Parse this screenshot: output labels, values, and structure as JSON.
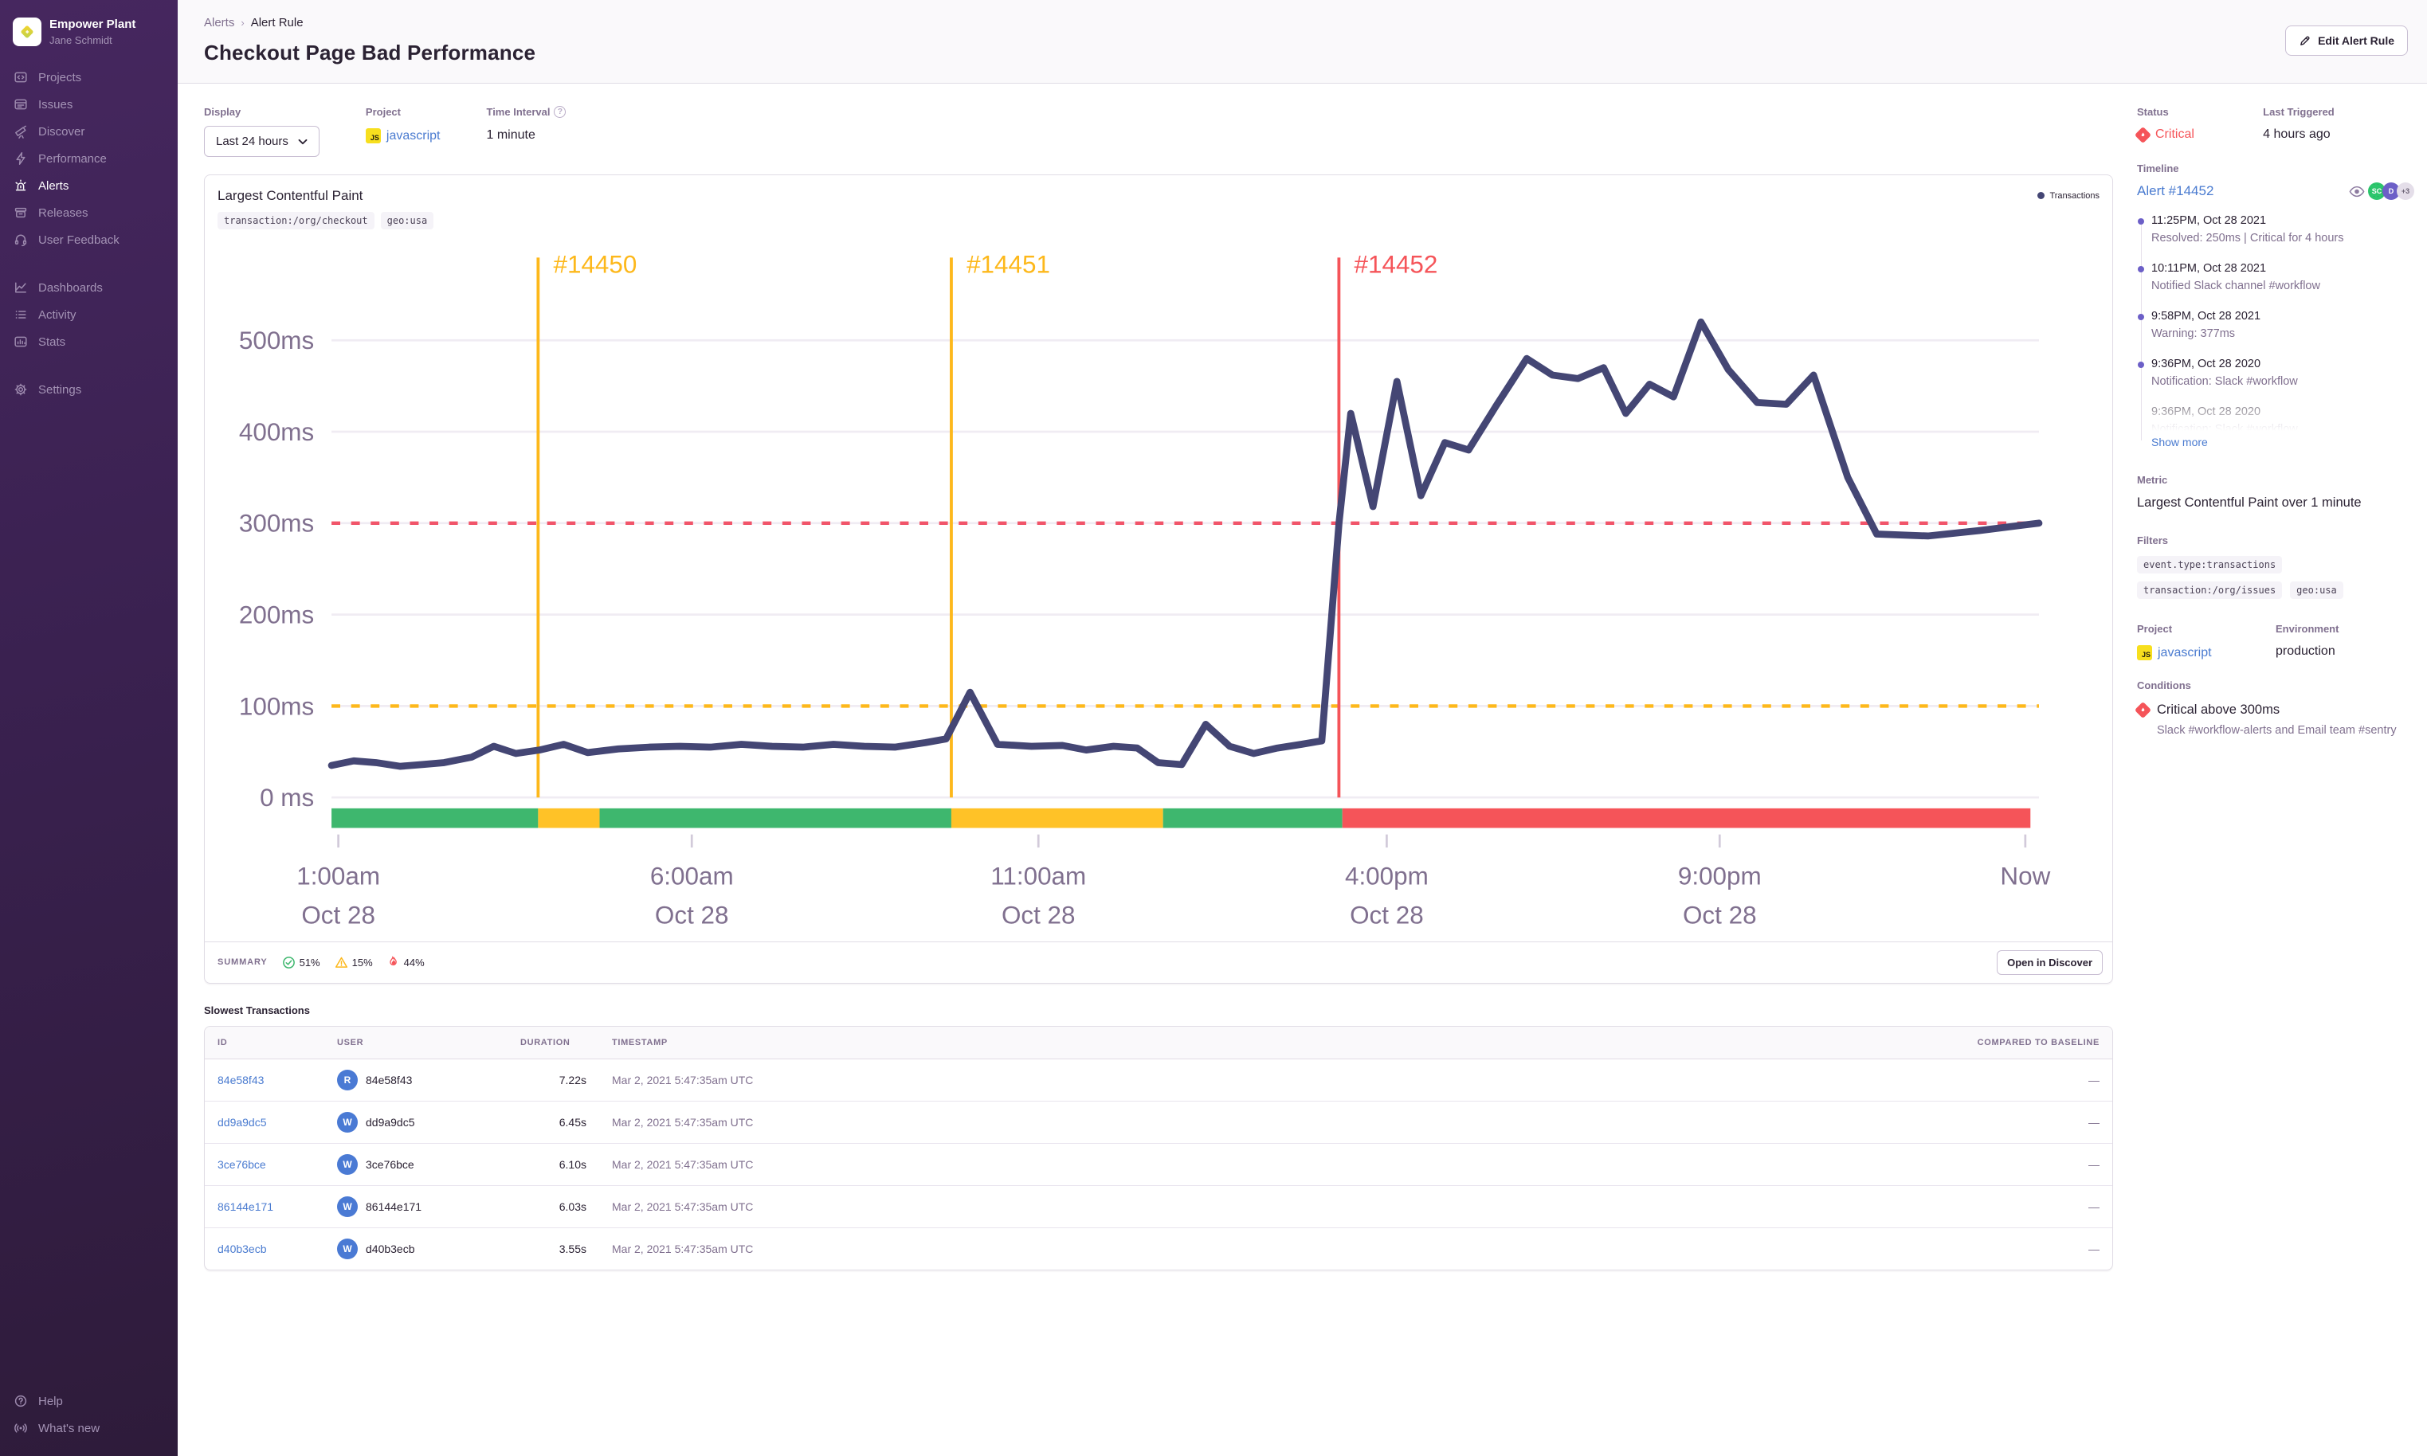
{
  "sidebar": {
    "org_name": "Empower Plant",
    "org_user": "Jane Schmidt",
    "items": [
      {
        "label": "Projects",
        "icon": "projects-icon",
        "active": false
      },
      {
        "label": "Issues",
        "icon": "issues-icon",
        "active": false
      },
      {
        "label": "Discover",
        "icon": "discover-icon",
        "active": false
      },
      {
        "label": "Performance",
        "icon": "performance-icon",
        "active": false
      },
      {
        "label": "Alerts",
        "icon": "alerts-icon",
        "active": true
      },
      {
        "label": "Releases",
        "icon": "releases-icon",
        "active": false
      },
      {
        "label": "User Feedback",
        "icon": "user-feedback-icon",
        "active": false
      },
      {
        "label": "Dashboards",
        "icon": "dashboards-icon",
        "active": false
      },
      {
        "label": "Activity",
        "icon": "activity-icon",
        "active": false
      },
      {
        "label": "Stats",
        "icon": "stats-icon",
        "active": false
      },
      {
        "label": "Settings",
        "icon": "settings-icon",
        "active": false
      }
    ],
    "footer_items": [
      {
        "label": "Help",
        "icon": "help-icon"
      },
      {
        "label": "What's new",
        "icon": "whats-new-icon"
      }
    ]
  },
  "header": {
    "breadcrumb": [
      "Alerts",
      "Alert Rule"
    ],
    "title": "Checkout Page Bad Performance",
    "edit_button": "Edit Alert Rule"
  },
  "controls": {
    "display_label": "Display",
    "display_value": "Last 24 hours",
    "project_label": "Project",
    "project_value": "javascript",
    "interval_label": "Time Interval",
    "interval_value": "1 minute"
  },
  "status_panel": {
    "status_label": "Status",
    "status_value": "Critical",
    "last_triggered_label": "Last Triggered",
    "last_triggered_value": "4 hours ago"
  },
  "chart": {
    "title": "Largest Contentful Paint",
    "tags": [
      "transaction:/org/checkout",
      "geo:usa"
    ],
    "legend": "Transactions",
    "line_color": "#444674",
    "ylim": [
      0,
      500
    ],
    "unit": "ms",
    "y_ticks": [
      {
        "value": 0,
        "label": "0 ms"
      },
      {
        "value": 100,
        "label": "100ms"
      },
      {
        "value": 200,
        "label": "200ms"
      },
      {
        "value": 300,
        "label": "300ms"
      },
      {
        "value": 400,
        "label": "400ms"
      },
      {
        "value": 500,
        "label": "500ms"
      }
    ],
    "thresholds": [
      {
        "ms": 300,
        "color": "#f1556a",
        "name": "critical"
      },
      {
        "ms": 100,
        "color": "#fdb81b",
        "name": "warning"
      }
    ],
    "markers": [
      {
        "label": "#14450",
        "frac": 0.121,
        "color": "#fdb81b"
      },
      {
        "label": "#14451",
        "frac": 0.363,
        "color": "#fdb81b"
      },
      {
        "label": "#14452",
        "frac": 0.59,
        "color": "#f55459"
      }
    ],
    "strip": [
      {
        "from": 0.0,
        "to": 0.121,
        "color": "#3eb76e"
      },
      {
        "from": 0.121,
        "to": 0.157,
        "color": "#ffc227"
      },
      {
        "from": 0.157,
        "to": 0.363,
        "color": "#3eb76e"
      },
      {
        "from": 0.363,
        "to": 0.487,
        "color": "#ffc227"
      },
      {
        "from": 0.487,
        "to": 0.592,
        "color": "#3eb76e"
      },
      {
        "from": 0.592,
        "to": 0.995,
        "color": "#f55459"
      }
    ],
    "x_ticks": [
      {
        "frac": 0.004,
        "label": "1:00am",
        "sub": "Oct 28"
      },
      {
        "frac": 0.211,
        "label": "6:00am",
        "sub": "Oct 28"
      },
      {
        "frac": 0.414,
        "label": "11:00am",
        "sub": "Oct 28"
      },
      {
        "frac": 0.618,
        "label": "4:00pm",
        "sub": "Oct 28"
      },
      {
        "frac": 0.813,
        "label": "9:00pm",
        "sub": "Oct 28"
      },
      {
        "frac": 0.992,
        "label": "Now",
        "sub": ""
      }
    ],
    "series": [
      [
        0.0,
        35
      ],
      [
        0.013,
        40
      ],
      [
        0.026,
        38
      ],
      [
        0.04,
        34
      ],
      [
        0.053,
        36
      ],
      [
        0.066,
        38
      ],
      [
        0.082,
        44
      ],
      [
        0.095,
        56
      ],
      [
        0.108,
        48
      ],
      [
        0.122,
        52
      ],
      [
        0.136,
        58
      ],
      [
        0.15,
        49
      ],
      [
        0.168,
        53
      ],
      [
        0.186,
        55
      ],
      [
        0.204,
        56
      ],
      [
        0.222,
        55
      ],
      [
        0.24,
        58
      ],
      [
        0.258,
        56
      ],
      [
        0.276,
        55
      ],
      [
        0.294,
        58
      ],
      [
        0.312,
        56
      ],
      [
        0.33,
        55
      ],
      [
        0.348,
        60
      ],
      [
        0.36,
        64
      ],
      [
        0.374,
        115
      ],
      [
        0.39,
        58
      ],
      [
        0.41,
        56
      ],
      [
        0.428,
        57
      ],
      [
        0.442,
        52
      ],
      [
        0.458,
        56
      ],
      [
        0.472,
        54
      ],
      [
        0.484,
        38
      ],
      [
        0.498,
        36
      ],
      [
        0.512,
        80
      ],
      [
        0.526,
        56
      ],
      [
        0.54,
        48
      ],
      [
        0.554,
        54
      ],
      [
        0.568,
        58
      ],
      [
        0.58,
        62
      ],
      [
        0.59,
        300
      ],
      [
        0.597,
        420
      ],
      [
        0.61,
        318
      ],
      [
        0.624,
        455
      ],
      [
        0.638,
        330
      ],
      [
        0.652,
        388
      ],
      [
        0.666,
        380
      ],
      [
        0.682,
        428
      ],
      [
        0.7,
        480
      ],
      [
        0.715,
        462
      ],
      [
        0.73,
        458
      ],
      [
        0.745,
        470
      ],
      [
        0.758,
        420
      ],
      [
        0.772,
        452
      ],
      [
        0.786,
        438
      ],
      [
        0.802,
        520
      ],
      [
        0.818,
        468
      ],
      [
        0.835,
        432
      ],
      [
        0.852,
        430
      ],
      [
        0.868,
        462
      ],
      [
        0.888,
        350
      ],
      [
        0.905,
        288
      ],
      [
        0.935,
        286
      ],
      [
        0.965,
        292
      ],
      [
        1.0,
        300
      ]
    ]
  },
  "summary": {
    "label": "SUMMARY",
    "ok": "51%",
    "warn": "15%",
    "crit": "44%",
    "open_button": "Open in Discover"
  },
  "table": {
    "title": "Slowest Transactions",
    "columns": [
      "ID",
      "USER",
      "DURATION",
      "TIMESTAMP",
      "COMPARED TO BASELINE"
    ],
    "rows": [
      {
        "id": "84e58f43",
        "avatar": "R",
        "user": "84e58f43",
        "duration": "7.22s",
        "timestamp": "Mar 2, 2021 5:47:35am UTC",
        "baseline": "—"
      },
      {
        "id": "dd9a9dc5",
        "avatar": "W",
        "user": "dd9a9dc5",
        "duration": "6.45s",
        "timestamp": "Mar 2, 2021 5:47:35am UTC",
        "baseline": "—"
      },
      {
        "id": "3ce76bce",
        "avatar": "W",
        "user": "3ce76bce",
        "duration": "6.10s",
        "timestamp": "Mar 2, 2021 5:47:35am UTC",
        "baseline": "—"
      },
      {
        "id": "86144e171",
        "avatar": "W",
        "user": "86144e171",
        "duration": "6.03s",
        "timestamp": "Mar 2, 2021 5:47:35am UTC",
        "baseline": "—"
      },
      {
        "id": "d40b3ecb",
        "avatar": "W",
        "user": "d40b3ecb",
        "duration": "3.55s",
        "timestamp": "Mar 2, 2021 5:47:35am UTC",
        "baseline": "—"
      }
    ]
  },
  "timeline": {
    "label": "Timeline",
    "alert_link": "Alert #14452",
    "avatars": [
      "SC",
      "D",
      "+3"
    ],
    "entries": [
      {
        "time": "11:25PM, Oct 28 2021",
        "desc": "Resolved: 250ms | Critical for 4 hours"
      },
      {
        "time": "10:11PM, Oct 28 2021",
        "desc": "Notified Slack channel #workflow"
      },
      {
        "time": "9:58PM, Oct 28 2021",
        "desc": "Warning: 377ms"
      },
      {
        "time": "9:36PM, Oct 28 2020",
        "desc": "Notification: Slack #workflow"
      },
      {
        "time": "9:36PM, Oct 28 2020",
        "desc": "Notification: Slack #workflow"
      }
    ],
    "show_more": "Show more"
  },
  "metric": {
    "label": "Metric",
    "value": "Largest Contentful Paint over 1 minute"
  },
  "filters": {
    "label": "Filters",
    "chips": [
      "event.type:transactions",
      "transaction:/org/issues",
      "geo:usa"
    ]
  },
  "project_env": {
    "project_label": "Project",
    "project_value": "javascript",
    "env_label": "Environment",
    "env_value": "production"
  },
  "conditions": {
    "label": "Conditions",
    "title": "Critical above 300ms",
    "subtitle": "Slack #workflow-alerts and Email team #sentry"
  },
  "colors": {
    "accent_purple": "#6c5fc7",
    "link_blue": "#4a7bd0",
    "critical_red": "#f55459",
    "warning_yellow": "#ffc227",
    "ok_green": "#3eb76e",
    "chart_line": "#444674"
  }
}
